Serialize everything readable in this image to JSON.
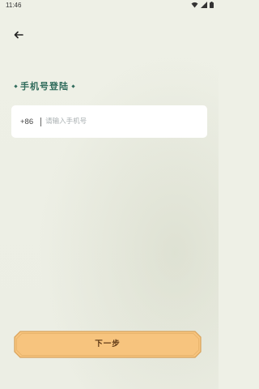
{
  "status_bar": {
    "time": "11:46",
    "icons": [
      "wifi-icon",
      "signal-icon",
      "battery-icon"
    ]
  },
  "header": {
    "back_icon": "arrow-left-icon"
  },
  "login": {
    "title": "手机号登陆",
    "country_code": "+86",
    "phone_placeholder": "请输入手机号",
    "phone_value": ""
  },
  "actions": {
    "next_label": "下一步"
  },
  "colors": {
    "background": "#eef0e6",
    "title_accent": "#2f6b5b",
    "button_fill": "#f7c47e",
    "button_border": "#d8a25a",
    "button_text": "#5a3412"
  }
}
